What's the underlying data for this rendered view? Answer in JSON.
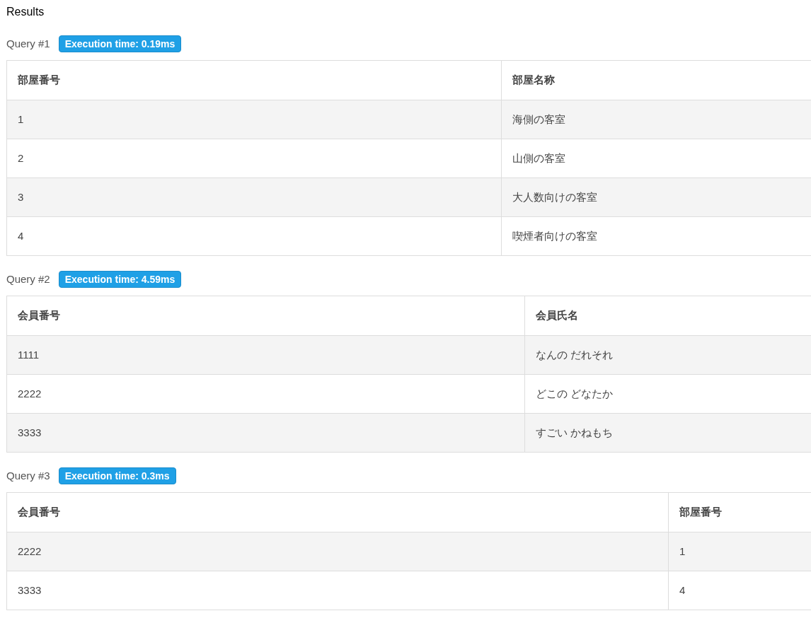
{
  "title": "Results",
  "queries": [
    {
      "label": "Query #1",
      "badge": "Execution time: 0.19ms",
      "columns": [
        "部屋番号",
        "部屋名称"
      ],
      "rows": [
        [
          "1",
          "海側の客室"
        ],
        [
          "2",
          "山側の客室"
        ],
        [
          "3",
          "大人数向けの客室"
        ],
        [
          "4",
          "喫煙者向けの客室"
        ]
      ]
    },
    {
      "label": "Query #2",
      "badge": "Execution time: 4.59ms",
      "columns": [
        "会員番号",
        "会員氏名"
      ],
      "rows": [
        [
          "1111",
          "なんの だれそれ"
        ],
        [
          "2222",
          "どこの どなたか"
        ],
        [
          "3333",
          "すごい かねもち"
        ]
      ]
    },
    {
      "label": "Query #3",
      "badge": "Execution time: 0.3ms",
      "columns": [
        "会員番号",
        "部屋番号"
      ],
      "rows": [
        [
          "2222",
          "1"
        ],
        [
          "3333",
          "4"
        ]
      ]
    }
  ]
}
